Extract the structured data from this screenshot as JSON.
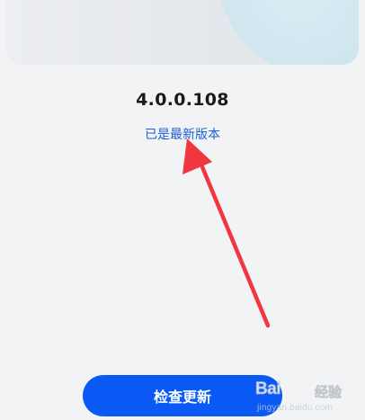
{
  "about": {
    "version": "4.0.0.108",
    "status": "已是最新版本"
  },
  "actions": {
    "check_update_label": "检查更新"
  },
  "annotation": {
    "color": "#f0373f"
  },
  "watermark": {
    "logo": "Bai",
    "text": "经验",
    "subtext": "jingyan.baidu.com"
  },
  "theme": {
    "accent": "#0a59f7",
    "link": "#1f5fd6",
    "background": "#f1f3f5"
  }
}
